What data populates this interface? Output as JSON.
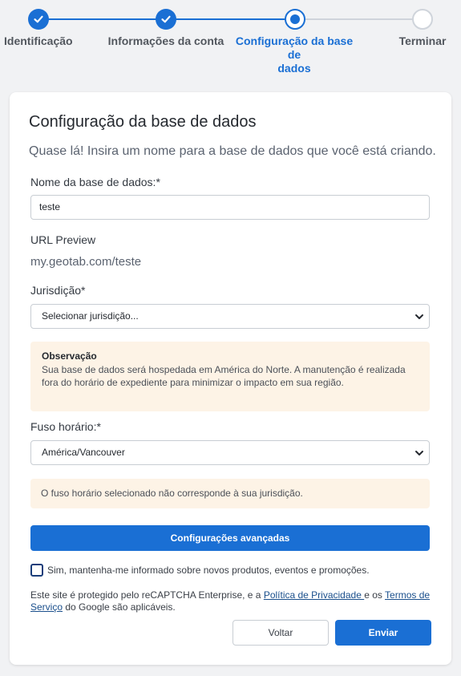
{
  "stepper": {
    "steps": [
      {
        "label": "Identificação",
        "state": "done"
      },
      {
        "label": "Informações da conta",
        "state": "done"
      },
      {
        "label_line1": "Configuração da base de",
        "label_line2": "dados",
        "state": "current"
      },
      {
        "label": "Terminar",
        "state": "todo"
      }
    ]
  },
  "card": {
    "title": "Configuração da base de dados",
    "subtitle": "Quase lá! Insira um nome para a base de dados que você está criando."
  },
  "form": {
    "db_name_label": "Nome da base de dados:*",
    "db_name_value": "teste",
    "url_preview_label": "URL Preview",
    "url_preview_value": "my.geotab.com/teste",
    "jurisdiction_label": "Jurisdição*",
    "jurisdiction_value": "Selecionar jurisdição...",
    "note_title": "Observação",
    "note_text": "Sua base de dados será hospedada em América do Norte. A manutenção é realizada fora do horário de expediente para minimizar o impacto em sua região.",
    "timezone_label": "Fuso horário:*",
    "timezone_value": "América/Vancouver",
    "timezone_warning": "O fuso horário selecionado não corresponde à sua jurisdição.",
    "advanced_button": "Configurações avançadas",
    "newsletter_label": "Sim, mantenha-me informado sobre novos produtos, eventos e promoções.",
    "newsletter_checked": false
  },
  "legal": {
    "prefix": "Este site é protegido pelo reCAPTCHA Enterprise, e a ",
    "privacy_link": "Política de Privacidade ",
    "middle": "e os ",
    "terms_link": "Termos de Serviço",
    "suffix": " do Google são aplicáveis."
  },
  "actions": {
    "back_label": "Voltar",
    "send_label": "Enviar"
  },
  "colors": {
    "accent": "#1a6fd4",
    "note_background": "#fdf3e6",
    "page_background": "#f1f2f4"
  },
  "icons": {
    "done_step": "check-icon",
    "select_arrow": "chevron-down-icon"
  }
}
